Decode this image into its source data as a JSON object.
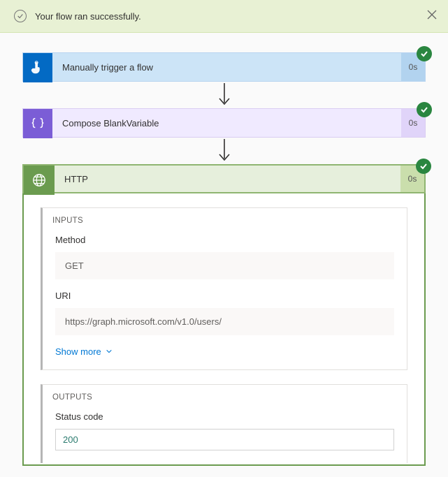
{
  "notification": {
    "message": "Your flow ran successfully."
  },
  "steps": [
    {
      "title": "Manually trigger a flow",
      "duration": "0s"
    },
    {
      "title": "Compose BlankVariable",
      "duration": "0s"
    },
    {
      "title": "HTTP",
      "duration": "0s"
    }
  ],
  "inputs": {
    "header": "INPUTS",
    "method_label": "Method",
    "method_value": "GET",
    "uri_label": "URI",
    "uri_value": "https://graph.microsoft.com/v1.0/users/",
    "show_more": "Show more"
  },
  "outputs": {
    "header": "OUTPUTS",
    "status_label": "Status code",
    "status_value": "200"
  }
}
